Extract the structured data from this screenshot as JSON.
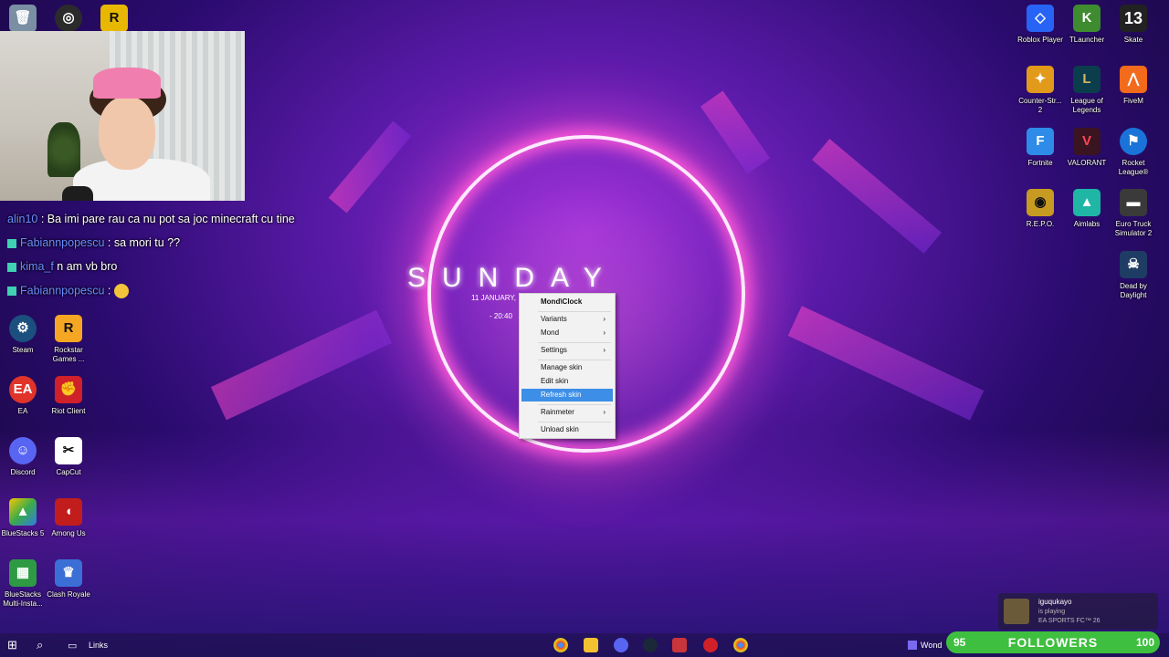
{
  "wallpaper": {
    "day": "SUNDAY",
    "date": "11 JANUARY,",
    "time": "- 20:40"
  },
  "desktop_left": [
    {
      "label": "Steam",
      "icon": "steam-icon",
      "color": "#1b4f7d"
    },
    {
      "label": "Rockstar Games ...",
      "icon": "rockstar-icon",
      "color": "#f5a623"
    },
    {
      "label": "EA",
      "icon": "ea-icon",
      "color": "#e0342b"
    },
    {
      "label": "Riot Client",
      "icon": "riot-icon",
      "color": "#d0202a"
    },
    {
      "label": "Discord",
      "icon": "discord-icon",
      "color": "#5865f2"
    },
    {
      "label": "CapCut",
      "icon": "capcut-icon",
      "color": "#111111"
    },
    {
      "label": "BlueStacks 5",
      "icon": "bluestacks-icon",
      "color": "#3cab4a"
    },
    {
      "label": "Among Us",
      "icon": "among-us-icon",
      "color": "#c21d1d"
    },
    {
      "label": "BlueStacks Multi-Insta...",
      "icon": "bluestacks-multi-icon",
      "color": "#2e9b44"
    },
    {
      "label": "Clash Royale",
      "icon": "clash-royale-icon",
      "color": "#3b6fd6"
    }
  ],
  "desktop_right": [
    {
      "label": "Roblox Player",
      "icon": "roblox-icon",
      "color": "#2764f5"
    },
    {
      "label": "TLauncher",
      "icon": "tlauncher-icon",
      "color": "#3f8b2f"
    },
    {
      "label": "Skate",
      "icon": "skate-icon",
      "color": "#222222"
    },
    {
      "label": "Counter-Str... 2",
      "icon": "counter-strike-icon",
      "color": "#e29a1a"
    },
    {
      "label": "League of Legends",
      "icon": "league-icon",
      "color": "#0b3d4d"
    },
    {
      "label": "FiveM",
      "icon": "fivem-icon",
      "color": "#f26a1b"
    },
    {
      "label": "Fortnite",
      "icon": "fortnite-icon",
      "color": "#2e8be8"
    },
    {
      "label": "VALORANT",
      "icon": "valorant-icon",
      "color": "#fd4556"
    },
    {
      "label": "Rocket League®",
      "icon": "rocket-league-icon",
      "color": "#1a73d9"
    },
    {
      "label": "R.E.P.O.",
      "icon": "repo-icon",
      "color": "#c79a22"
    },
    {
      "label": "Aimlabs",
      "icon": "aimlabs-icon",
      "color": "#1fb6a6"
    },
    {
      "label": "Euro Truck Simulator 2",
      "icon": "euro-truck-icon",
      "color": "#3a3a3a"
    },
    {
      "label": "Dead by Daylight",
      "icon": "dead-by-daylight-icon",
      "color": "#1f3c64"
    }
  ],
  "top_left_icons": [
    {
      "label": "",
      "icon": "recycle-bin-icon",
      "color": "#7a8fa3"
    },
    {
      "label": "",
      "icon": "obs-icon",
      "color": "#2b2b2b"
    },
    {
      "label": "",
      "icon": "game-launcher-icon",
      "color": "#e8b800"
    }
  ],
  "chat": [
    {
      "user": "alin10",
      "text": " : Ba imi pare rau ca nu pot sa joc minecraft cu tine"
    },
    {
      "user": "Fabiannpopescu",
      "text": " : sa mori tu ??"
    },
    {
      "user": "kima_f",
      "text": " n am vb bro"
    },
    {
      "user": "Fabiannpopescu",
      "text": " : "
    }
  ],
  "context_menu": {
    "title": "Mond\\Clock",
    "items": [
      {
        "label": "Variants",
        "submenu": true
      },
      {
        "label": "Mond",
        "submenu": true
      },
      {
        "label": "Settings",
        "submenu": true
      },
      {
        "label": "Manage skin",
        "submenu": false
      },
      {
        "label": "Edit skin",
        "submenu": false
      },
      {
        "label": "Refresh skin",
        "submenu": false,
        "selected": true
      },
      {
        "label": "Rainmeter",
        "submenu": true
      },
      {
        "label": "Unload skin",
        "submenu": false
      }
    ]
  },
  "taskbar": {
    "links_label": "Links",
    "right_label": "Wond"
  },
  "notification": {
    "name": "iguqukayo",
    "status": "is playing",
    "game": "EA SPORTS FC™ 26"
  },
  "followers": {
    "current": "95",
    "label": "FOLLOWERS",
    "goal": "100"
  },
  "top_right_counter": "13"
}
